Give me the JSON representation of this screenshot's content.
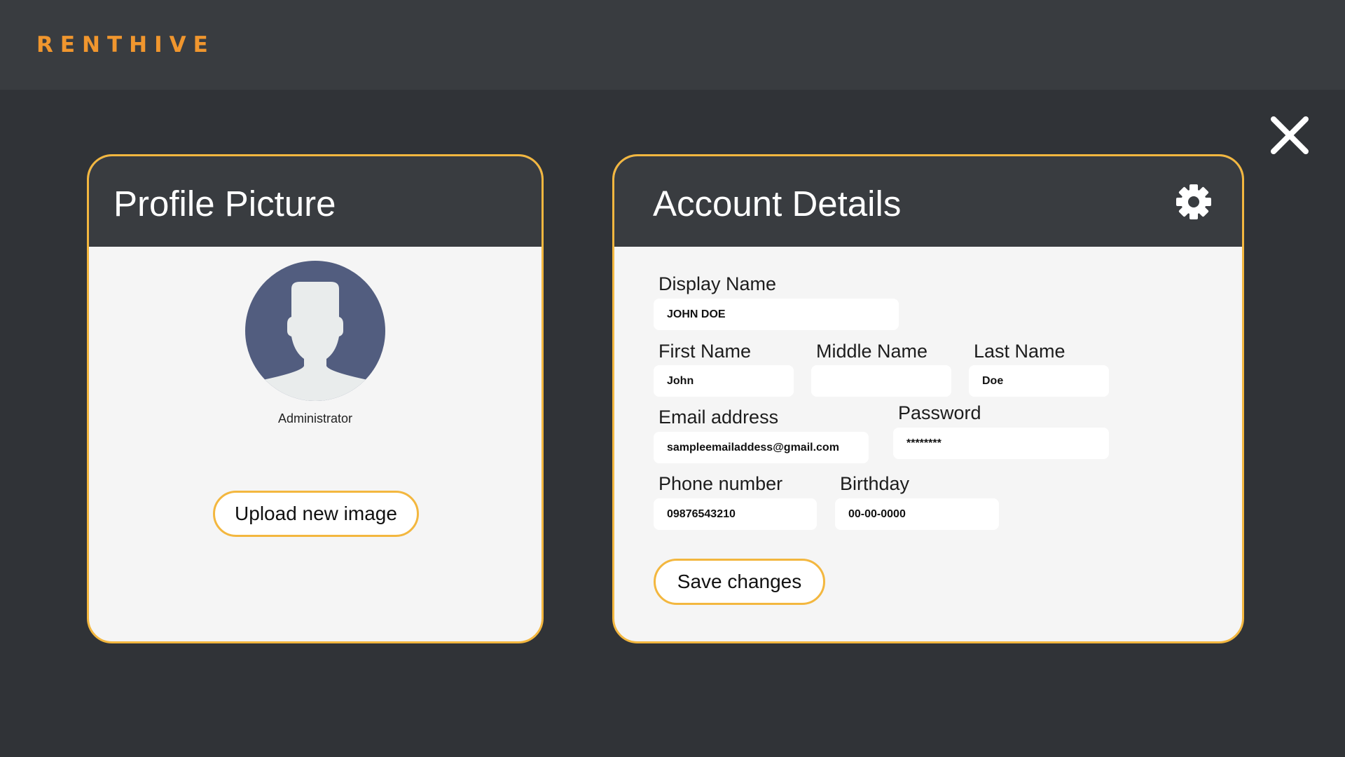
{
  "app": {
    "logo": "RENTHIVE"
  },
  "profile": {
    "title": "Profile Picture",
    "role": "Administrator",
    "upload_label": "Upload new image"
  },
  "account": {
    "title": "Account Details",
    "fields": {
      "display_name": {
        "label": "Display Name",
        "value": "JOHN DOE"
      },
      "first_name": {
        "label": "First Name",
        "value": "John"
      },
      "middle_name": {
        "label": "Middle Name",
        "value": ""
      },
      "last_name": {
        "label": "Last Name",
        "value": "Doe"
      },
      "email": {
        "label": "Email address",
        "value": "sampleemailaddess@gmail.com"
      },
      "password": {
        "label": "Password",
        "value": "********"
      },
      "phone": {
        "label": "Phone number",
        "value": "09876543210"
      },
      "birthday": {
        "label": "Birthday",
        "value": "00-00-0000"
      }
    },
    "save_label": "Save changes"
  },
  "icons": {
    "close": "close-icon",
    "settings": "gear-icon",
    "avatar": "user-avatar-icon"
  },
  "colors": {
    "accent": "#f3b73f",
    "logo": "#f0962e",
    "background": "#303337",
    "header": "#393c40",
    "avatar_bg": "#525d7f",
    "avatar_fg": "#e9ecec"
  }
}
